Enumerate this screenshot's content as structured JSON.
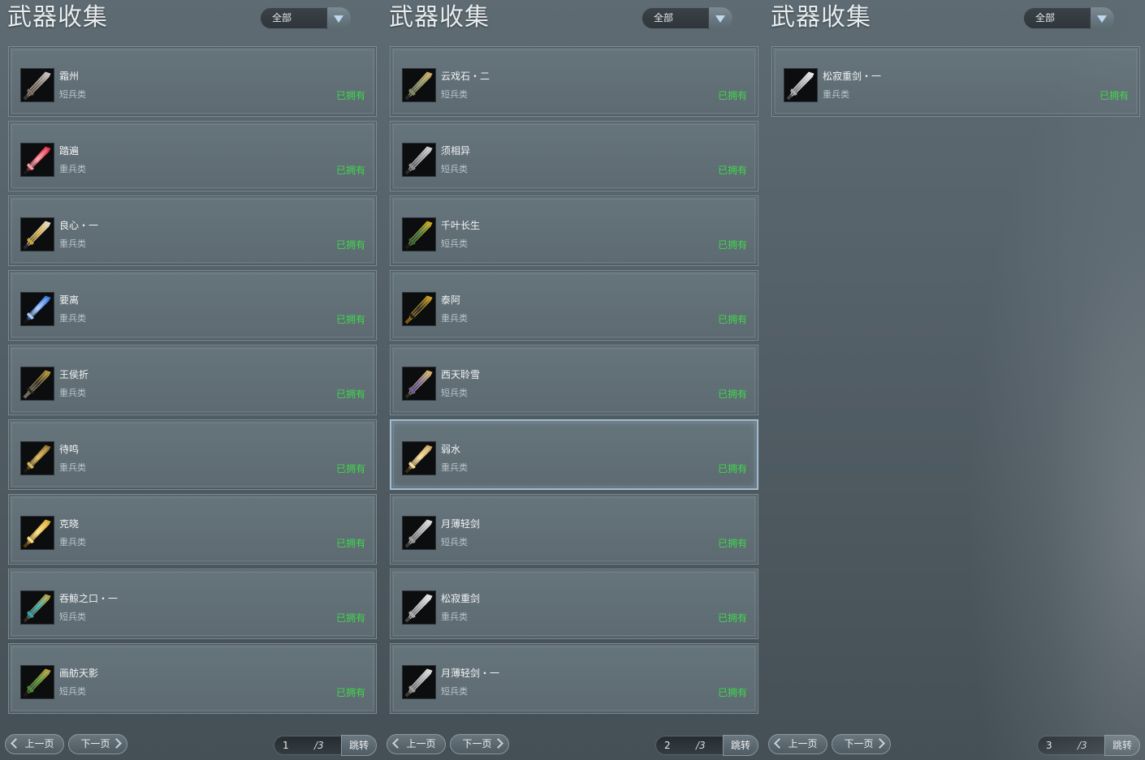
{
  "panels": [
    {
      "title": "武器收集",
      "filter": "全部",
      "page_current": "1",
      "page_total": "/3",
      "prev_label": "上一页",
      "next_label": "下一页",
      "jump_label": "跳转",
      "items": [
        {
          "name": "霜州",
          "type": "短兵类",
          "status": "已拥有",
          "icon": "silver-hilt-sword-icon"
        },
        {
          "name": "踏遍",
          "type": "重兵类",
          "status": "已拥有",
          "icon": "red-greatsword-icon"
        },
        {
          "name": "良心・一",
          "type": "重兵类",
          "status": "已拥有",
          "icon": "gold-white-greatsword-icon"
        },
        {
          "name": "要离",
          "type": "重兵类",
          "status": "已拥有",
          "icon": "blue-greatsword-icon"
        },
        {
          "name": "王侯折",
          "type": "重兵类",
          "status": "已拥有",
          "icon": "gold-black-greatsword-icon"
        },
        {
          "name": "待鸣",
          "type": "重兵类",
          "status": "已拥有",
          "icon": "dark-gold-greatsword-icon"
        },
        {
          "name": "克晓",
          "type": "重兵类",
          "status": "已拥有",
          "icon": "golden-greatsword-icon"
        },
        {
          "name": "吞鲸之口・一",
          "type": "短兵类",
          "status": "已拥有",
          "icon": "teal-gold-blade-icon"
        },
        {
          "name": "画舫天影",
          "type": "短兵类",
          "status": "已拥有",
          "icon": "green-gold-sword-icon"
        }
      ]
    },
    {
      "title": "武器收集",
      "filter": "全部",
      "page_current": "2",
      "page_total": "/3",
      "prev_label": "上一页",
      "next_label": "下一页",
      "jump_label": "跳转",
      "items": [
        {
          "name": "云戏石・二",
          "type": "短兵类",
          "status": "已拥有",
          "icon": "ornate-gold-sword-icon"
        },
        {
          "name": "须相异",
          "type": "短兵类",
          "status": "已拥有",
          "icon": "curved-silver-blade-icon"
        },
        {
          "name": "千叶长生",
          "type": "短兵类",
          "status": "已拥有",
          "icon": "gold-ring-sword-icon"
        },
        {
          "name": "泰阿",
          "type": "重兵类",
          "status": "已拥有",
          "icon": "gold-black-heavy-blade-icon"
        },
        {
          "name": "西天聆雪",
          "type": "短兵类",
          "status": "已拥有",
          "icon": "gold-purple-sword-icon"
        },
        {
          "name": "弱水",
          "type": "重兵类",
          "status": "已拥有",
          "icon": "bronze-greatsword-icon"
        },
        {
          "name": "月薄轻剑",
          "type": "短兵类",
          "status": "已拥有",
          "icon": "silver-light-sword-icon"
        },
        {
          "name": "松寂重剑",
          "type": "重兵类",
          "status": "已拥有",
          "icon": "silver-greatsword-icon"
        },
        {
          "name": "月薄轻剑・一",
          "type": "短兵类",
          "status": "已拥有",
          "icon": "silver-light-sword-icon"
        }
      ]
    },
    {
      "title": "武器收集",
      "filter": "全部",
      "page_current": "3",
      "page_total": "/3",
      "prev_label": "上一页",
      "next_label": "下一页",
      "jump_label": "跳转",
      "items": [
        {
          "name": "松寂重剑・一",
          "type": "重兵类",
          "status": "已拥有",
          "icon": "silver-greatsword-icon"
        }
      ]
    }
  ],
  "colors": {
    "status_owned": "#3fd84a",
    "selected_border": "#a9c4d8"
  },
  "selected_item": {
    "panel": 1,
    "index": 5
  }
}
